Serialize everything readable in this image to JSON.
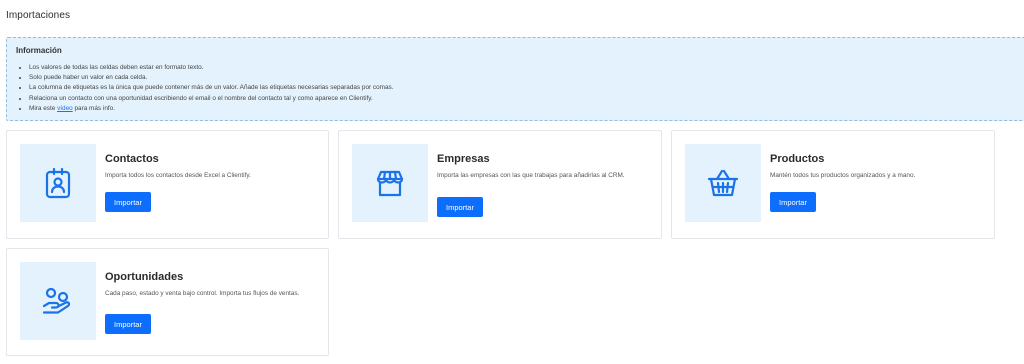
{
  "page": {
    "title": "Importaciones"
  },
  "info": {
    "title": "Información",
    "items": [
      "Los valores de todas las celdas deben estar en formato texto.",
      "Solo puede haber un valor en cada celda.",
      "La columna de etiquetas es la única que puede contener más de un valor. Añade las etiquetas necesarias separadas por comas.",
      "Relaciona un contacto con una oportunidad escribiendo el email o el nombre del contacto tal y como aparece en Clientify."
    ],
    "last_item": {
      "prefix": "Mira este ",
      "link": "vídeo",
      "suffix": " para más info."
    }
  },
  "cards": [
    {
      "title": "Contactos",
      "description": "Importa todos los contactos desde Excel a Clientify.",
      "button": "Importar",
      "icon": "contact-badge-icon"
    },
    {
      "title": "Empresas",
      "description": "Importa las empresas con las que trabajas para añadirlas al CRM.",
      "button": "Importar",
      "icon": "store-icon"
    },
    {
      "title": "Productos",
      "description": "Mantén todos tus productos organizados y a mano.",
      "button": "Importar",
      "icon": "basket-icon"
    },
    {
      "title": "Oportunidades",
      "description": "Cada paso, estado y venta bajo control. Importa tus flujos de ventas.",
      "button": "Importar",
      "icon": "hand-coins-icon"
    }
  ],
  "colors": {
    "accent": "#0d6efd",
    "icon": "#1a73e8",
    "info_bg": "#e3f2fd"
  }
}
